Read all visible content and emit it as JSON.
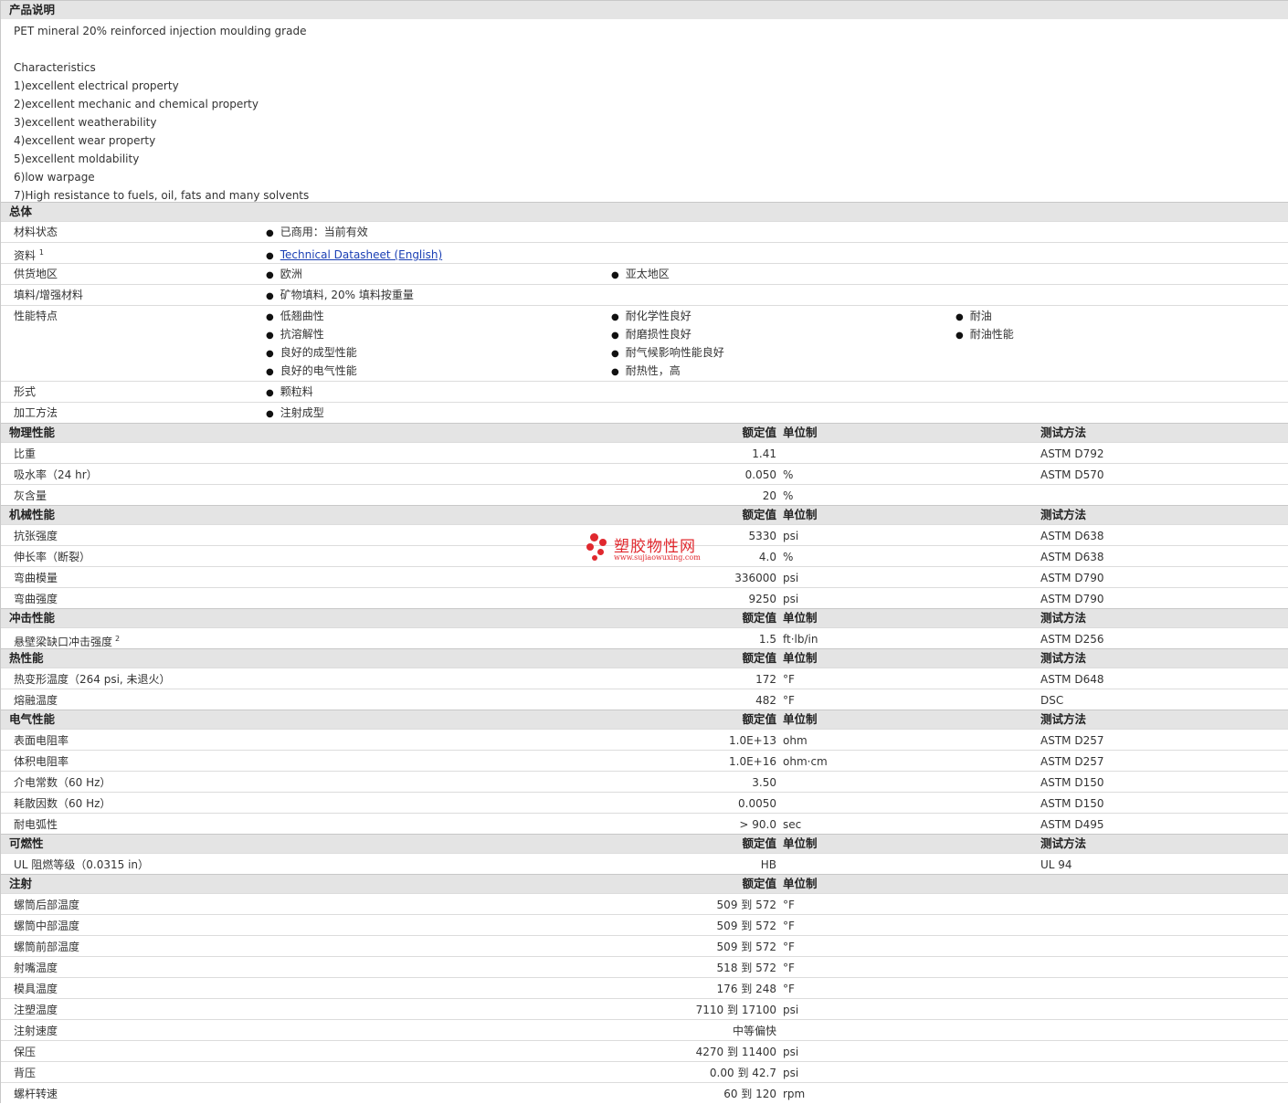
{
  "description": {
    "header": "产品说明",
    "lines": [
      "PET mineral 20% reinforced injection moulding grade",
      "",
      "Characteristics",
      "1)excellent electrical property",
      "2)excellent mechanic and chemical property",
      "3)excellent weatherability",
      "4)excellent wear property",
      "5)excellent moldability",
      "6)low warpage",
      "7)High resistance to fuels, oil, fats and many solvents"
    ]
  },
  "general": {
    "header": "总体",
    "status_label": "材料状态",
    "status_value": "已商用：当前有效",
    "docs_label": "资料",
    "docs_sup": "1",
    "docs_link": "Technical Datasheet (English)",
    "region_label": "供货地区",
    "region_1": "欧洲",
    "region_2": "亚太地区",
    "filler_label": "填料/增强材料",
    "filler_value": "矿物填料, 20% 填料按重量",
    "features_label": "性能特点",
    "features": [
      "低翘曲性",
      "抗溶解性",
      "良好的成型性能",
      "良好的电气性能",
      "耐化学性良好",
      "耐磨损性良好",
      "耐气候影响性能良好",
      "耐热性，高",
      "耐油",
      "耐油性能"
    ],
    "form_label": "形式",
    "form_value": "颗粒料",
    "process_label": "加工方法",
    "process_value": "注射成型"
  },
  "col_headers": {
    "value": "额定值",
    "unit": "单位制",
    "method": "测试方法"
  },
  "sections": [
    {
      "title": "物理性能",
      "rows": [
        {
          "label": "比重",
          "value": "1.41",
          "unit": "",
          "method": "ASTM D792"
        },
        {
          "label": "吸水率（24 hr）",
          "value": "0.050",
          "unit": "%",
          "method": "ASTM D570"
        },
        {
          "label": "灰含量",
          "value": "20",
          "unit": "%",
          "method": ""
        }
      ]
    },
    {
      "title": "机械性能",
      "rows": [
        {
          "label": "抗张强度",
          "value": "5330",
          "unit": "psi",
          "method": "ASTM D638"
        },
        {
          "label": "伸长率（断裂）",
          "value": "4.0",
          "unit": "%",
          "method": "ASTM D638"
        },
        {
          "label": "弯曲模量",
          "value": "336000",
          "unit": "psi",
          "method": "ASTM D790"
        },
        {
          "label": "弯曲强度",
          "value": "9250",
          "unit": "psi",
          "method": "ASTM D790"
        }
      ]
    },
    {
      "title": "冲击性能",
      "rows": [
        {
          "label": "悬壁梁缺口冲击强度",
          "sup": "2",
          "value": "1.5",
          "unit": "ft·lb/in",
          "method": "ASTM D256"
        }
      ]
    },
    {
      "title": "热性能",
      "rows": [
        {
          "label": "热变形温度（264 psi, 未退火）",
          "value": "172",
          "unit": "°F",
          "method": "ASTM D648"
        },
        {
          "label": "熔融温度",
          "value": "482",
          "unit": "°F",
          "method": "DSC"
        }
      ]
    },
    {
      "title": "电气性能",
      "rows": [
        {
          "label": "表面电阻率",
          "value": "1.0E+13",
          "unit": "ohm",
          "method": "ASTM D257"
        },
        {
          "label": "体积电阻率",
          "value": "1.0E+16",
          "unit": "ohm·cm",
          "method": "ASTM D257"
        },
        {
          "label": "介电常数（60 Hz）",
          "value": "3.50",
          "unit": "",
          "method": "ASTM D150"
        },
        {
          "label": "耗散因数（60 Hz）",
          "value": "0.0050",
          "unit": "",
          "method": "ASTM D150"
        },
        {
          "label": "耐电弧性",
          "value": "> 90.0",
          "unit": "sec",
          "method": "ASTM D495"
        }
      ]
    },
    {
      "title": "可燃性",
      "rows": [
        {
          "label": "UL 阻燃等级（0.0315 in）",
          "value": "HB",
          "unit": "",
          "method": "UL 94"
        }
      ]
    },
    {
      "title": "注射",
      "no_method": true,
      "rows": [
        {
          "label": "螺筒后部温度",
          "value": "509 到  572",
          "unit": "°F",
          "method": ""
        },
        {
          "label": "螺筒中部温度",
          "value": "509 到  572",
          "unit": "°F",
          "method": ""
        },
        {
          "label": "螺筒前部温度",
          "value": "509 到  572",
          "unit": "°F",
          "method": ""
        },
        {
          "label": "射嘴温度",
          "value": "518 到  572",
          "unit": "°F",
          "method": ""
        },
        {
          "label": "模具温度",
          "value": "176 到  248",
          "unit": "°F",
          "method": ""
        },
        {
          "label": "注塑温度",
          "value": "7110 到  17100",
          "unit": "psi",
          "method": ""
        },
        {
          "label": "注射速度",
          "value": "中等偏快",
          "unit": "",
          "method": ""
        },
        {
          "label": "保压",
          "value": "4270 到  11400",
          "unit": "psi",
          "method": ""
        },
        {
          "label": "背压",
          "value": "0.00 到  42.7",
          "unit": "psi",
          "method": ""
        },
        {
          "label": "螺杆转速",
          "value": "60 到  120",
          "unit": "rpm",
          "method": ""
        }
      ]
    }
  ],
  "watermark": {
    "cn": "塑胶物性网",
    "en": "www.sujiaowuxing.com"
  }
}
